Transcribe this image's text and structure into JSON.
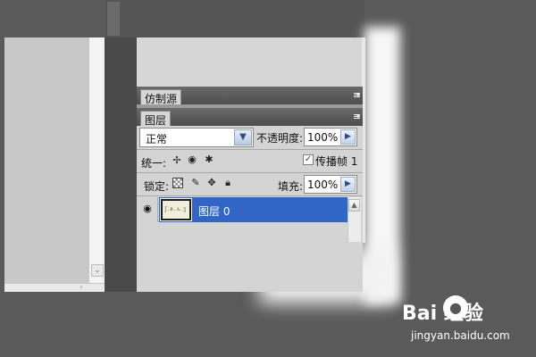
{
  "panels": {
    "clone_source": {
      "tab_label": "仿制源"
    },
    "layers": {
      "tab_label": "图层",
      "blend_mode": {
        "value": "正常"
      },
      "opacity": {
        "label": "不透明度:",
        "value": "100%"
      },
      "unify": {
        "label": "统一:"
      },
      "propagate_frame": {
        "label": "传播帧 1",
        "checked": true
      },
      "lock": {
        "label": "锁定:"
      },
      "fill": {
        "label": "填充:",
        "value": "100%"
      },
      "layer_rows": [
        {
          "name": "图层 0",
          "visible": true,
          "thumbnail_text": "ʃ.ʀ.ʌ.ʒ"
        }
      ]
    }
  },
  "icons": {
    "eye": "eye-icon",
    "menu": "panel-menu-icon",
    "dropdown": "chevron-down-icon",
    "arrow": "arrow-right-icon"
  },
  "colors": {
    "selected_row": "#3266c6",
    "panel_bg": "#d4d4d4",
    "header_bg": "#5a5a5a"
  },
  "watermark": {
    "brand": "Bai  经验",
    "url": "jingyan.baidu.com"
  }
}
